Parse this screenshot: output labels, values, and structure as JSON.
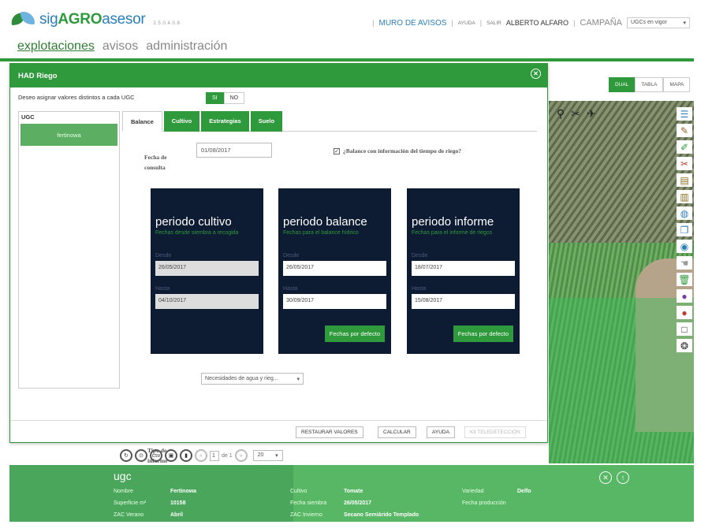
{
  "brand": {
    "name_prefix": "sig",
    "name_main": "AGRO",
    "name_suffix": "asesor",
    "subtitle": "2.5.0.4.0.8"
  },
  "topnav": {
    "muro": "MURO DE AVISOS",
    "ayuda": "AYUDA",
    "salir": "SALIR",
    "user": "ALBERTO ALFARO",
    "campaign_label": "CAMPAÑA",
    "campaign_value": "UGCs en vigor"
  },
  "mainnav": [
    "explotaciones",
    "avisos",
    "administración"
  ],
  "views": [
    "DUAL",
    "TABLA",
    "MAPA"
  ],
  "modal": {
    "title": "HAD Riego",
    "assign_label": "Deseo asignar valores distintos a cada UGC",
    "yes": "SI",
    "no": "NO",
    "list_header": "UGC",
    "list_items": [
      "fertinowa"
    ],
    "tabs": [
      "Balance",
      "Cultivo",
      "Estrategias",
      "Suelo"
    ],
    "fecha_label_1": "Fecha de",
    "fecha_label_2": "consulta",
    "fecha_value": "01/08/2017",
    "checkbox_label": "¿Balance con información del tiempo de riego?",
    "cards": [
      {
        "title": "periodo cultivo",
        "subtitle": "Fechas desde siembra a recogida",
        "desde_label": "Desde",
        "desde": "26/05/2017",
        "hasta_label": "Hasta",
        "hasta": "04/10/2017",
        "button": ""
      },
      {
        "title": "periodo balance",
        "subtitle": "Fechas para el balance hídrico",
        "desde_label": "Desde",
        "desde": "26/05/2017",
        "hasta_label": "Hasta",
        "hasta": "30/09/2017",
        "button": "Fechas por defecto"
      },
      {
        "title": "periodo informe",
        "subtitle": "Fechas para el informe de riegos",
        "desde_label": "Desde",
        "desde": "18/07/2017",
        "hasta_label": "Hasta",
        "hasta": "15/08/2017",
        "button": "Fechas por defecto"
      }
    ],
    "tipo_label_1": "Tipo de",
    "tipo_label_2": "informe",
    "tipo_value": "Necesidades de agua y rieg...",
    "footer": {
      "restaurar": "RESTAURAR VALORES",
      "calcular": "CALCULAR",
      "ayuda": "AYUDA",
      "teledet": "Kit TELEDETECCIÓN"
    }
  },
  "pager": {
    "page": "1",
    "of_label": "de 1",
    "page_size": "20"
  },
  "ugc_panel": {
    "title": "ugc",
    "fields": {
      "nombre_label": "Nombre",
      "nombre": "Fertinowa",
      "superficie_label": "Superficie m²",
      "superficie": "10158",
      "zac_verano_label": "ZAC Verano",
      "zac_verano": "Abril",
      "cultivo_label": "Cultivo",
      "cultivo": "Tomate",
      "fecha_siembra_label": "Fecha siembra",
      "fecha_siembra": "26/05/2017",
      "zac_invierno_label": "ZAC Invierno",
      "zac_invierno": "Secano Semiárido Templado",
      "variedad_label": "Variedad",
      "variedad": "Delfo",
      "fecha_produccion_label": "Fecha producción"
    }
  },
  "colors": {
    "accent": "#2e9a3b",
    "card_bg": "#0d1b33",
    "brand_blue": "#2b7fb8"
  }
}
